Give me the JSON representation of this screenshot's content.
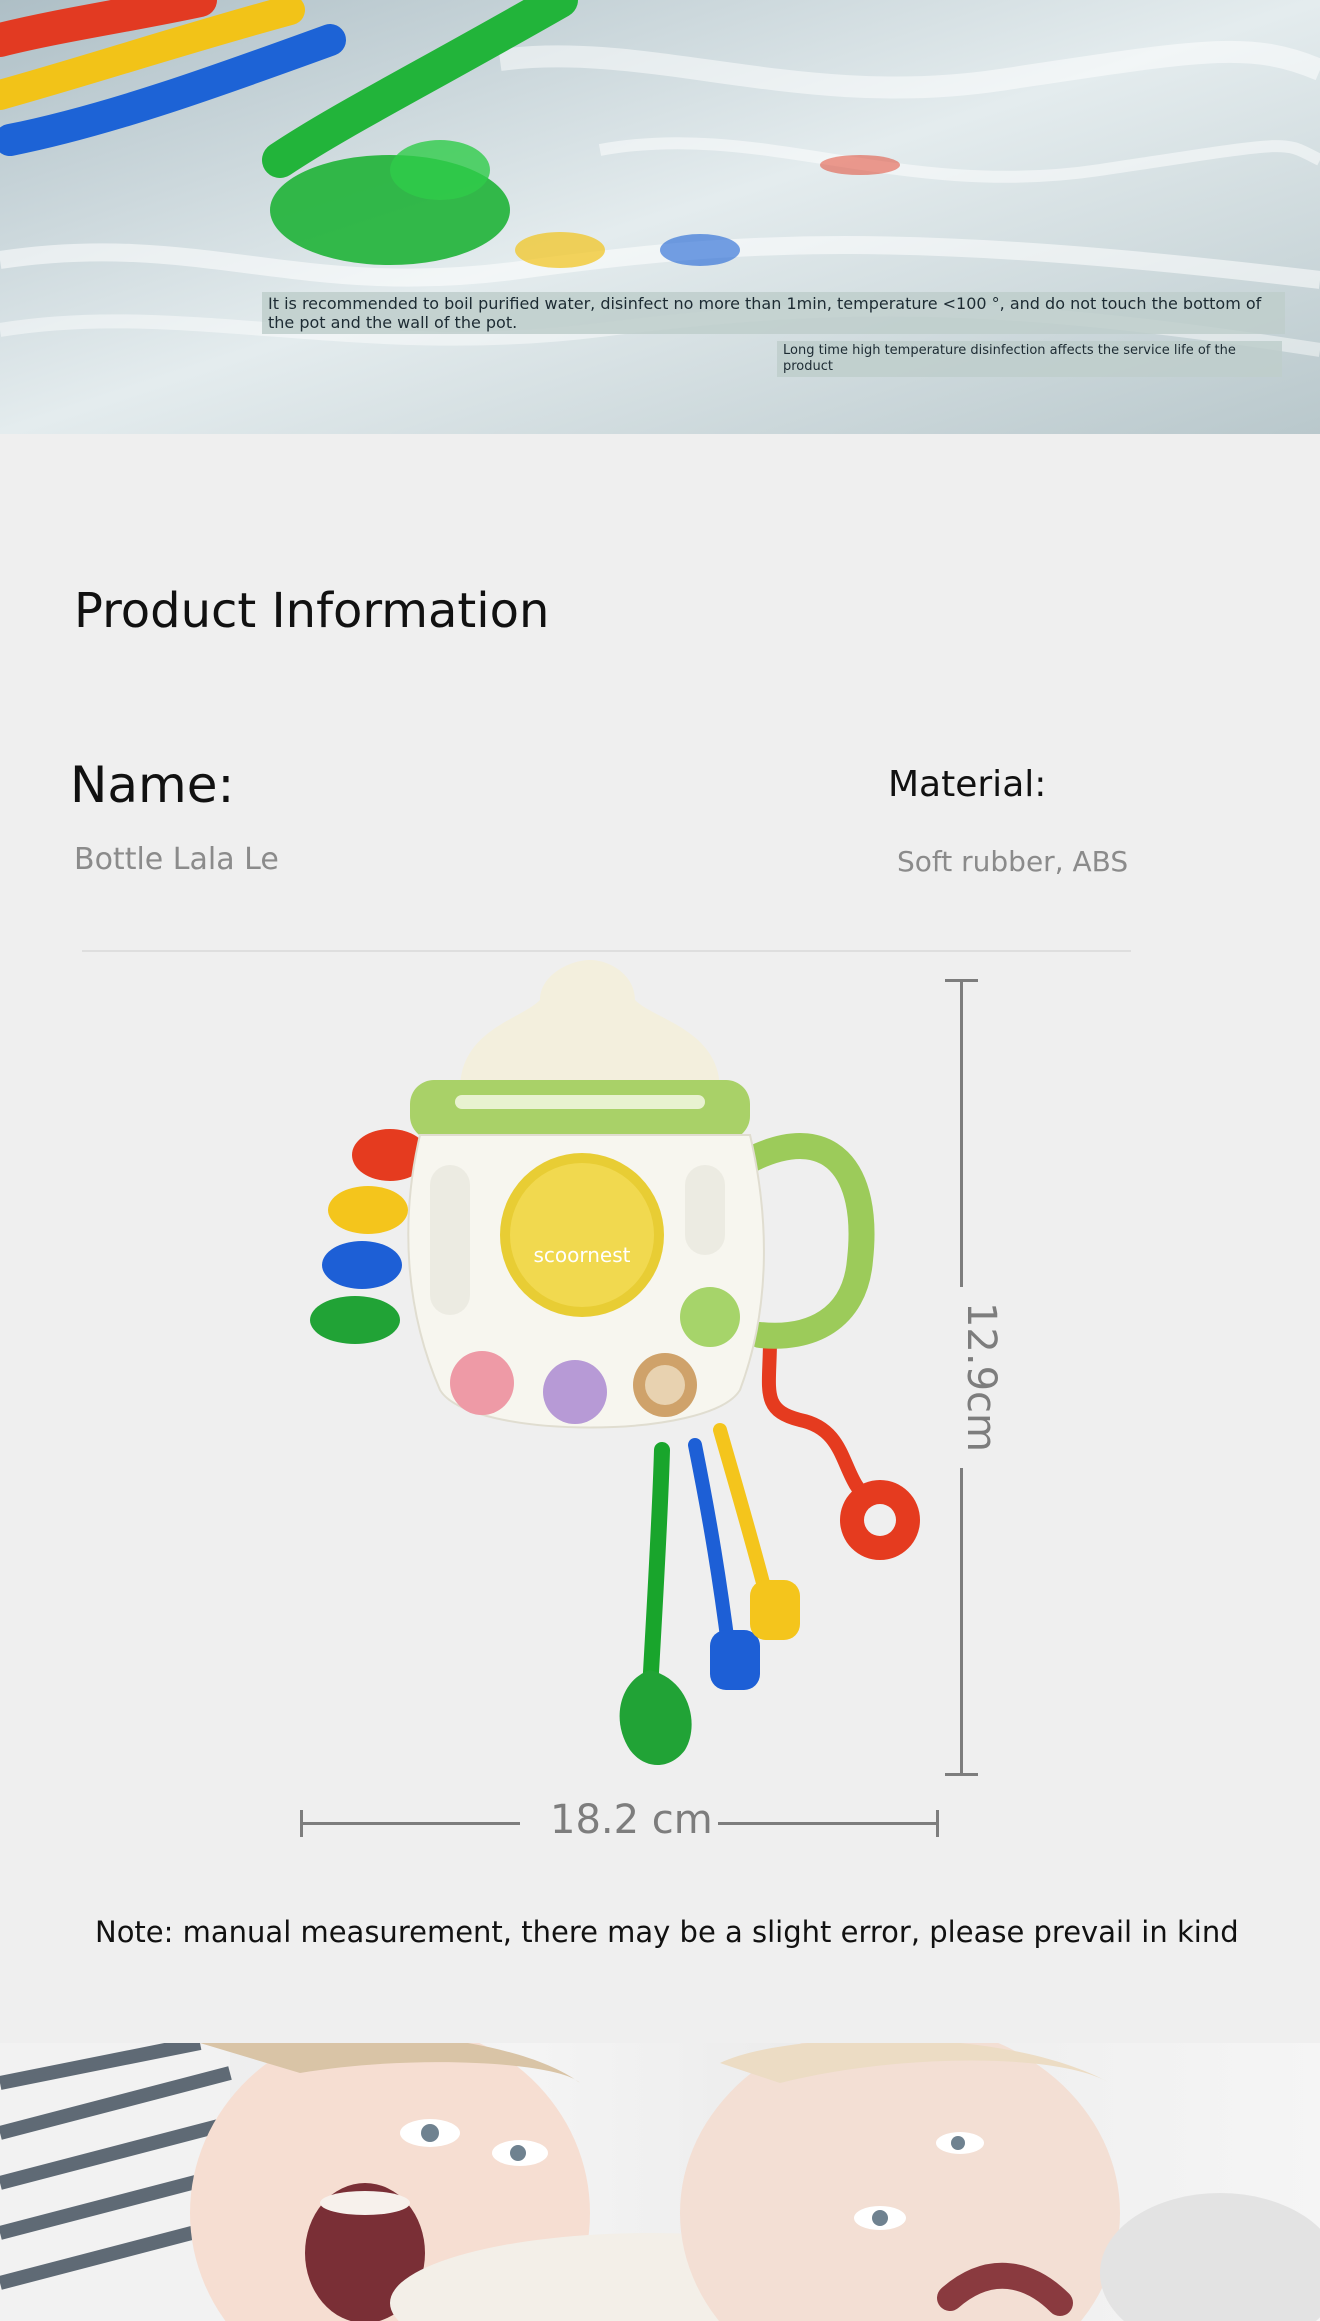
{
  "hero": {
    "note_primary": "It is recommended to boil purified water, disinfect no more than 1min, temperature <100 °, and do not touch the bottom of the pot and the wall of the pot.",
    "note_secondary": "Long time high temperature disinfection affects the service life of the product"
  },
  "product_info": {
    "title": "Product Information",
    "name_label": "Name:",
    "name_value": "Bottle Lala Le",
    "material_label": "Material:",
    "material_value": "Soft rubber, ABS"
  },
  "product_image": {
    "brand_text": "scoornest"
  },
  "dimensions": {
    "height_label": "12.9cm",
    "width_label": "18.2 cm"
  },
  "note": "Note: manual measurement, there may be a slight error, please prevail in kind",
  "colors": {
    "background": "#efefef",
    "dimension_gray": "#7d7d7d",
    "secondary_text": "#8b8b8b"
  }
}
